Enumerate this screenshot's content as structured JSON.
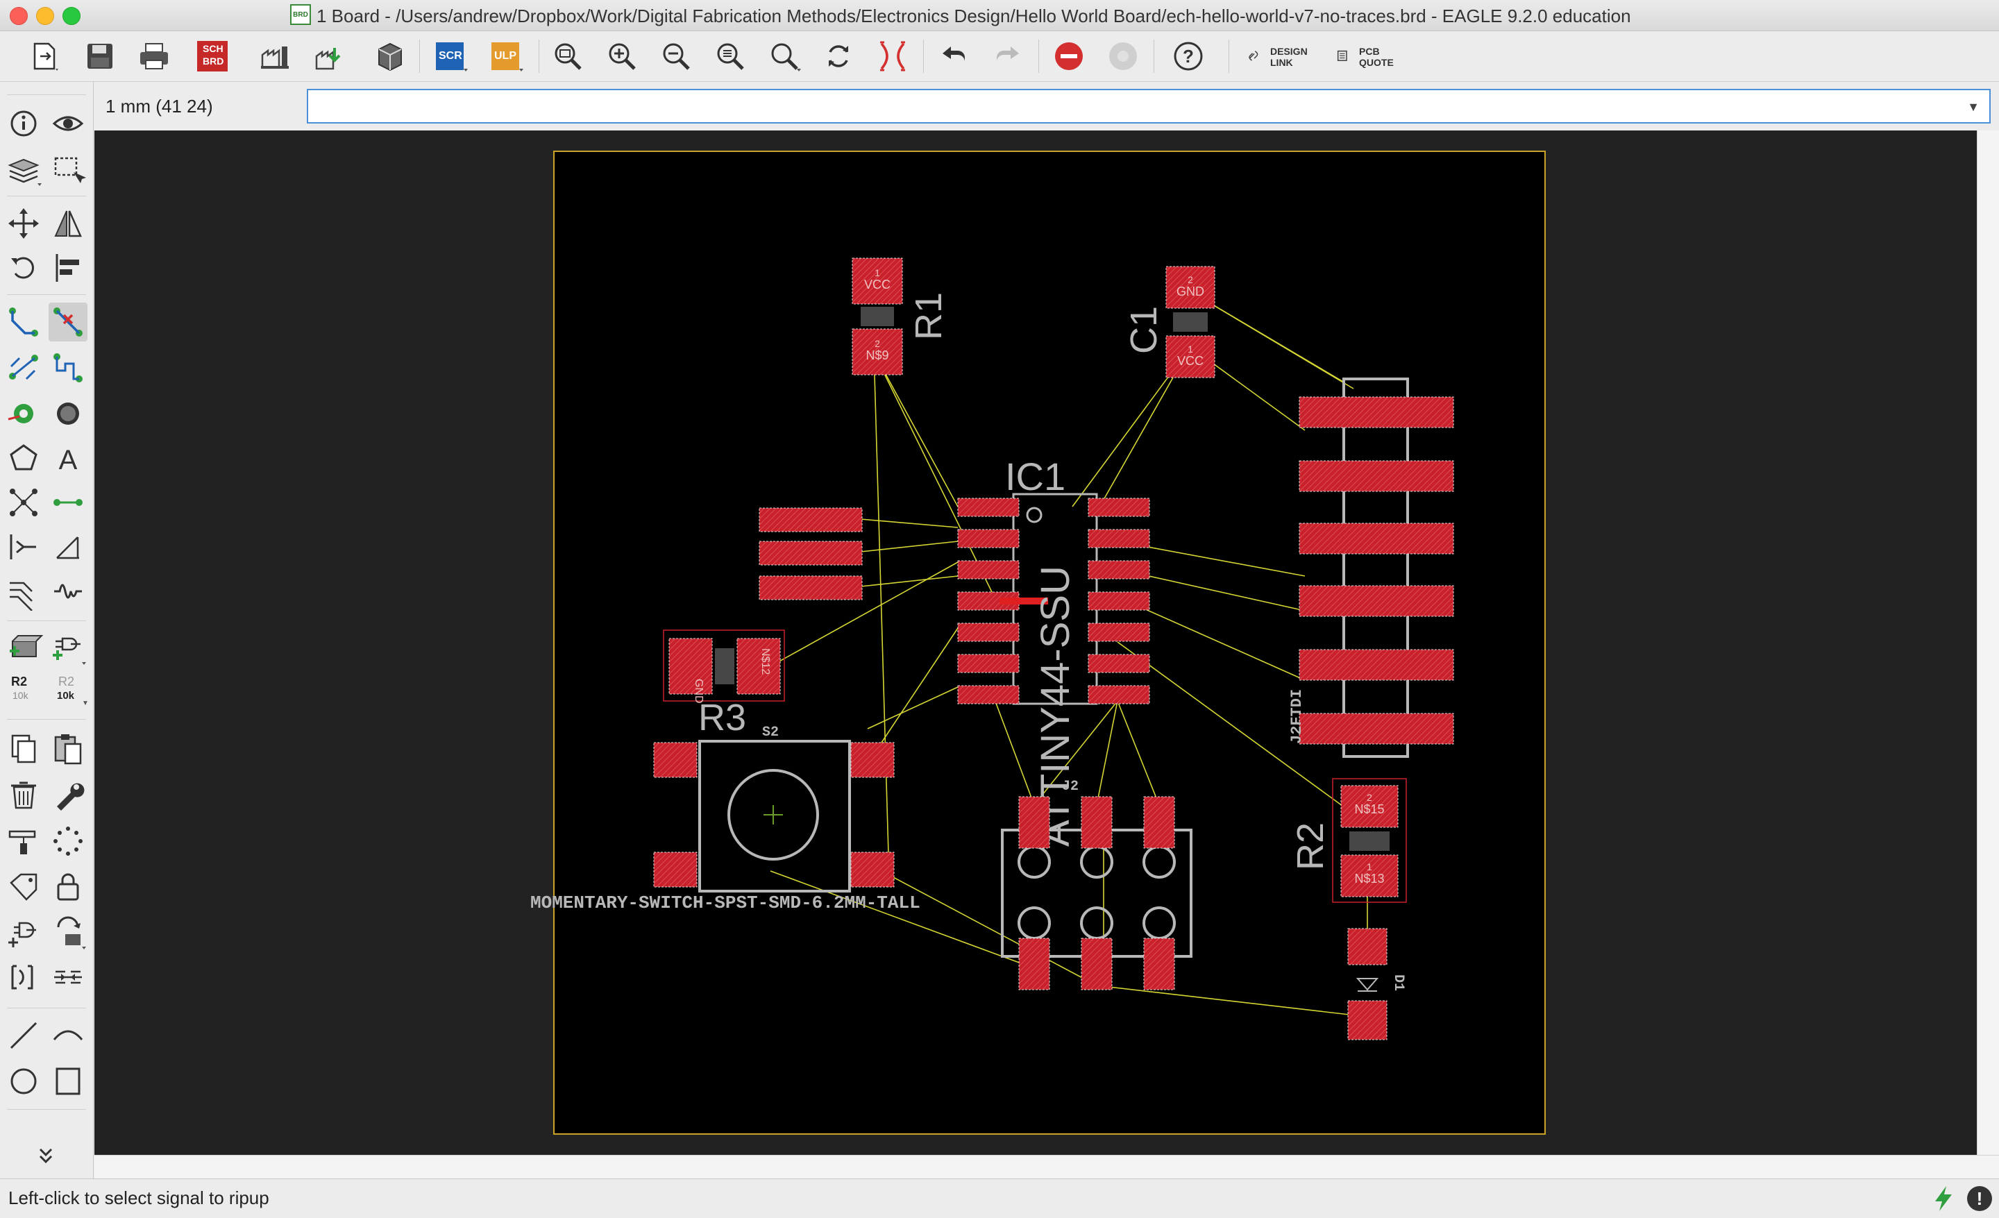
{
  "window": {
    "title": "1 Board - /Users/andrew/Dropbox/Work/Digital Fabrication Methods/Electronics Design/Hello World Board/ech-hello-world-v7-no-traces.brd - EAGLE 9.2.0 education",
    "title_icon_text": "BRD"
  },
  "toolbar": {
    "sch_brd_label_top": "SCH",
    "sch_brd_label_bottom": "BRD",
    "scr_label": "SCR",
    "ulp_label": "ULP",
    "design_link_line1": "DESIGN",
    "design_link_line2": "LINK",
    "pcb_quote_line1": "PCB",
    "pcb_quote_line2": "QUOTE"
  },
  "command": {
    "coordinate_readout": "1 mm (41 24)",
    "input_value": "",
    "input_placeholder": ""
  },
  "leftpanel": {
    "r2_label": "R2",
    "r2_value": "10k",
    "r2_label_disabled": "R2",
    "r2_value_disabled": "10k"
  },
  "board": {
    "parts": {
      "r1": "R1",
      "c1": "C1",
      "ic1": "IC1",
      "ic1_value": "ATTINY44-SSU",
      "r3": "R3",
      "s2": "S2",
      "r2": "R2",
      "j2": "J2",
      "j2ftdi": "J2FTDI",
      "d1": "D1",
      "switch_value": "MOMENTARY-SWITCH-SPST-SMD-6.2MM-TALL"
    },
    "pads": {
      "r1_p1": "1",
      "r1_p1_net": "VCC",
      "r1_p2": "2",
      "r1_p2_net": "N$9",
      "c1_p2": "2",
      "c1_p2_net": "GND",
      "c1_p1": "1",
      "c1_p1_net": "VCC",
      "r3_p2_net": "GND",
      "r3_p1_net": "N$12",
      "r2_p2": "2",
      "r2_p2_net": "N$15",
      "r2_p1": "1",
      "r2_p1_net": "N$13"
    }
  },
  "status": {
    "message": "Left-click to select signal to ripup"
  },
  "colors": {
    "pad": "#c8212b",
    "airwire": "#d6d633",
    "board_outline": "#c9a227",
    "silk": "#b8b8b8"
  }
}
